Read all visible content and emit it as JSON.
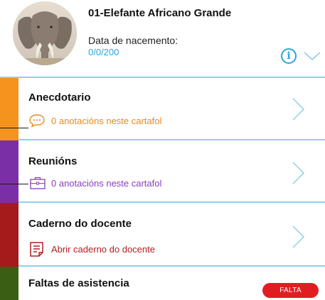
{
  "student": {
    "name": "01-Elefante Africano Grande",
    "birth_label": "Data de nacemento:",
    "birth_value": "0/0/200"
  },
  "header": {
    "info_glyph": "i"
  },
  "rows": [
    {
      "title": "Anecdotario",
      "subtitle": "0 anotacións neste cartafol",
      "icon": "speech-bubble-icon",
      "color": "#f5931f"
    },
    {
      "title": "Reunións",
      "subtitle": "0 anotacións neste cartafol",
      "icon": "briefcase-icon",
      "color": "#7a2fa6"
    },
    {
      "title": "Caderno do docente",
      "subtitle": "Abrir caderno do docente",
      "icon": "notebook-icon",
      "color": "#a51b1b"
    },
    {
      "title": "Faltas de asistencia",
      "badge": "FALTA",
      "color": "#3a5f14"
    }
  ],
  "colors": {
    "accent": "#29a8e0",
    "divider": "#8fd0ea",
    "badge": "#e21d22"
  }
}
